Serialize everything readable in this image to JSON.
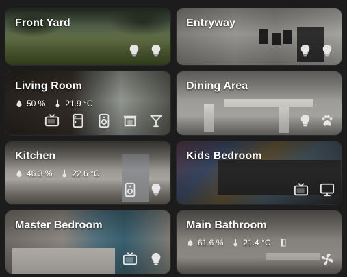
{
  "cards": [
    {
      "title": "Front Yard",
      "sensors": [],
      "icons": [
        "bulb-icon",
        "bulb-icon"
      ]
    },
    {
      "title": "Entryway",
      "sensors": [],
      "icons": [
        "bulb-icon",
        "bulb-icon"
      ]
    },
    {
      "title": "Living Room",
      "sensors": [
        {
          "icon": "humidity-icon",
          "value": "50 %"
        },
        {
          "icon": "thermometer-icon",
          "value": "21.9 °C"
        }
      ],
      "icons": [
        "tv-icon",
        "fridge-icon",
        "speaker-icon",
        "fireplace-icon",
        "cocktail-icon"
      ]
    },
    {
      "title": "Dining Area",
      "sensors": [],
      "icons": [
        "bulb-icon",
        "paw-icon"
      ]
    },
    {
      "title": "Kitchen",
      "sensors": [
        {
          "icon": "humidity-icon",
          "value": "46.3 %"
        },
        {
          "icon": "thermometer-icon",
          "value": "22.6 °C"
        }
      ],
      "icons": [
        "speaker-icon",
        "bulb-icon"
      ]
    },
    {
      "title": "Kids Bedroom",
      "sensors": [],
      "icons": [
        "tv-icon",
        "monitor-icon"
      ]
    },
    {
      "title": "Master Bedroom",
      "sensors": [],
      "icons": [
        "tv-icon",
        "bulb-icon"
      ]
    },
    {
      "title": "Main Bathroom",
      "sensors": [
        {
          "icon": "humidity-icon",
          "value": "61.6 %"
        },
        {
          "icon": "thermometer-icon",
          "value": "21.4 °C"
        },
        {
          "icon": "door-icon",
          "value": ""
        }
      ],
      "icons": [
        "fan-icon"
      ]
    }
  ],
  "colors": {
    "icon": "#e6e6e6",
    "background": "#1c1c1c"
  }
}
